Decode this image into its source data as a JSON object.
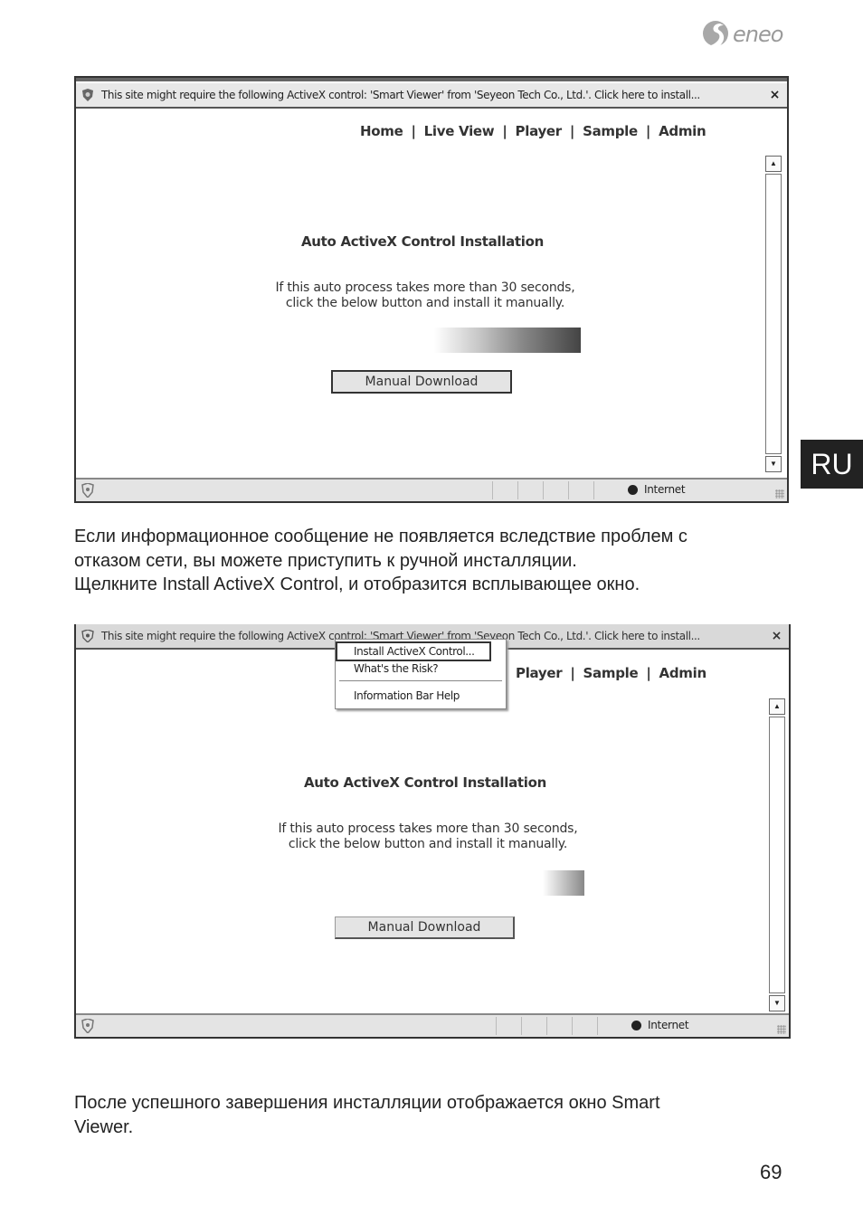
{
  "header": {
    "brand": "eneo",
    "logo_icon": "eneo-swirl-logo-icon",
    "language_tab": "RU"
  },
  "screenshot_1": {
    "infobar": {
      "icon": "shield-icon",
      "message": "This site might require the following ActiveX control: 'Smart Viewer' from 'Seyeon Tech Co., Ltd.'. Click here to install...",
      "close_label": "×"
    },
    "nav": [
      {
        "label": "Home"
      },
      {
        "label": "Live View"
      },
      {
        "label": "Player"
      },
      {
        "label": "Sample"
      },
      {
        "label": "Admin"
      }
    ],
    "nav_separator": "|",
    "title": "Auto ActiveX Control Installation",
    "description_line1": "If this auto process takes more than 30 seconds,",
    "description_line2": "click the below button and install it manually.",
    "button_label": "Manual Download",
    "statusbar": {
      "zone_icon": "globe-icon",
      "zone_label": "Internet"
    }
  },
  "screenshot_2": {
    "infobar": {
      "icon": "shield-icon",
      "message": "This site might require the following ActiveX control: 'Smart Viewer' from 'Seyeon Tech Co., Ltd.'. Click here to install...",
      "close_label": "×"
    },
    "context_menu": {
      "items": [
        {
          "label": "Install ActiveX Control...",
          "highlighted": true
        },
        {
          "label": "What's the Risk?"
        },
        {
          "label": "Information Bar Help"
        }
      ]
    },
    "nav": [
      {
        "label": "Player"
      },
      {
        "label": "Sample"
      },
      {
        "label": "Admin"
      }
    ],
    "nav_separator": "|",
    "title": "Auto ActiveX Control Installation",
    "description_line1": "If this auto process takes more than 30 seconds,",
    "description_line2": "click the below button and install it manually.",
    "button_label": "Manual Download",
    "statusbar": {
      "zone_icon": "globe-icon",
      "zone_label": "Internet"
    }
  },
  "body": {
    "paragraph_1_line1": "Если информационное сообщение не появляется вследствие проблем с",
    "paragraph_1_line2": "отказом сети, вы можете приступить к ручной инсталляции.",
    "paragraph_1_line3": "Щелкните Install ActiveX Control, и отобразится всплывающее окно.",
    "paragraph_2_line1": "После успешного завершения инсталляции отображается окно Smart",
    "paragraph_2_line2": "Viewer."
  },
  "footer": {
    "page_number": "69"
  }
}
